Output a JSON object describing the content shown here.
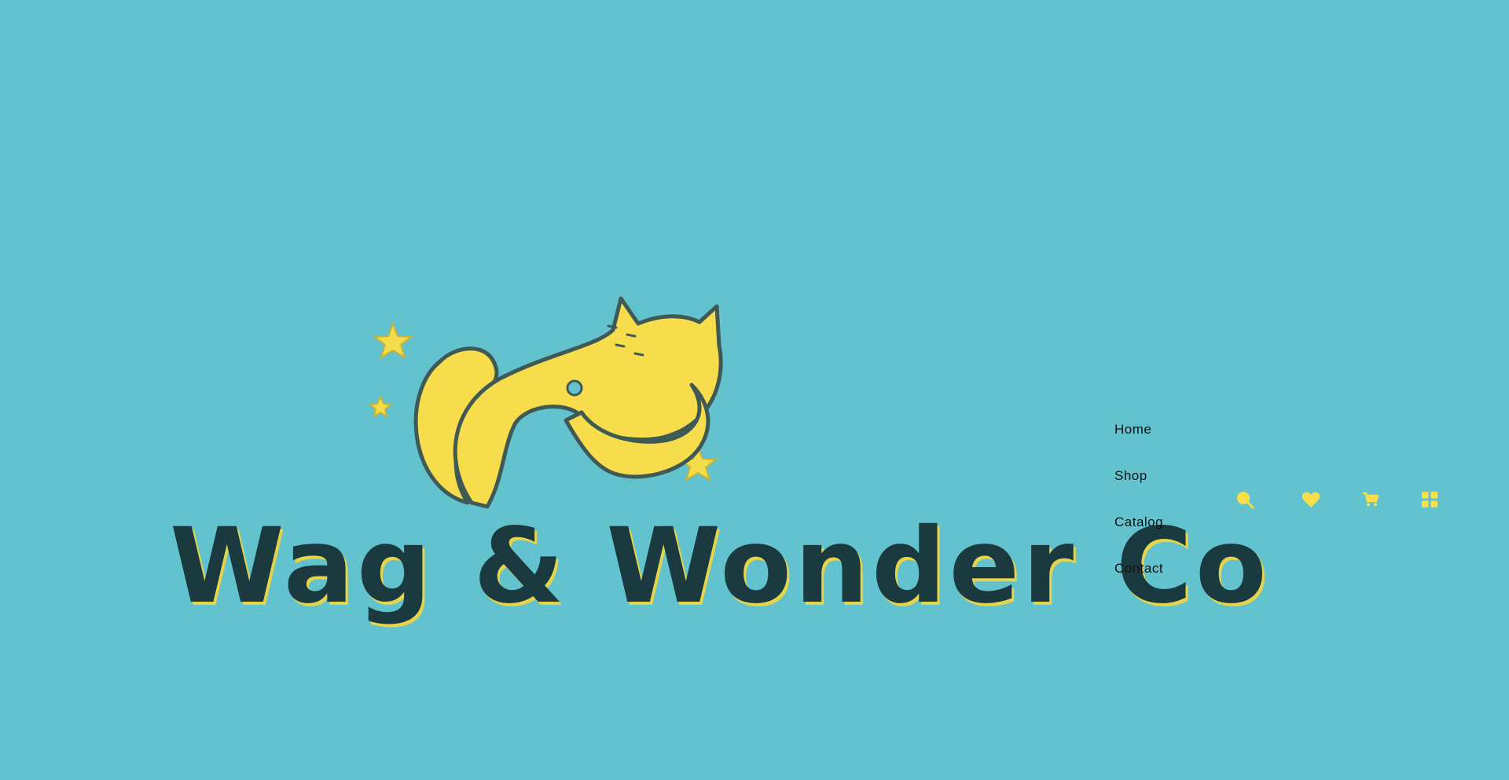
{
  "brand": {
    "name": "Wag & Wonder Co",
    "logo_icon": "cat-and-dog-with-stars-logo"
  },
  "nav": {
    "items": [
      {
        "label": "Home"
      },
      {
        "label": "Shop"
      },
      {
        "label": "Catalog"
      },
      {
        "label": "Contact"
      }
    ]
  },
  "header_icons": [
    {
      "icon": "search-icon"
    },
    {
      "icon": "heart-icon"
    },
    {
      "icon": "cart-icon"
    },
    {
      "icon": "grid-menu-icon"
    }
  ],
  "colors": {
    "background": "#62c2ce",
    "accent": "#f9e04b",
    "wordmark": "#1b3a40",
    "nav_text": "#111111"
  }
}
